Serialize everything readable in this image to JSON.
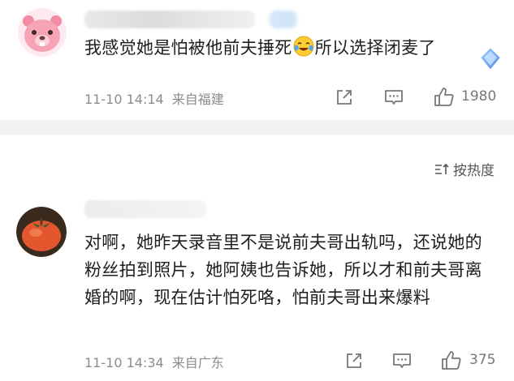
{
  "comments": [
    {
      "text_before_emoji": "我感觉她是怕被他前夫捶死",
      "emoji": "laughing-tears-icon",
      "text_after_emoji": "所以选择闭麦了",
      "date": "11-10 14:14",
      "location": "来自福建",
      "likes": "1980"
    },
    {
      "text": "对啊，她昨天录音里不是说前夫哥出轨吗，还说她的粉丝拍到照片，她阿姨也告诉她，所以才和前夫哥离婚的啊，现在估计怕死咯，怕前夫哥出来爆料",
      "date": "11-10 14:34",
      "location": "来自广东",
      "likes": "375"
    }
  ],
  "sort_label": "按热度",
  "colors": {
    "meta_text": "#8c8c8c",
    "divider": "#f2f2f2",
    "avatar_bear": "#f6a3b6",
    "avatar_persimmon": "#e4572e"
  }
}
